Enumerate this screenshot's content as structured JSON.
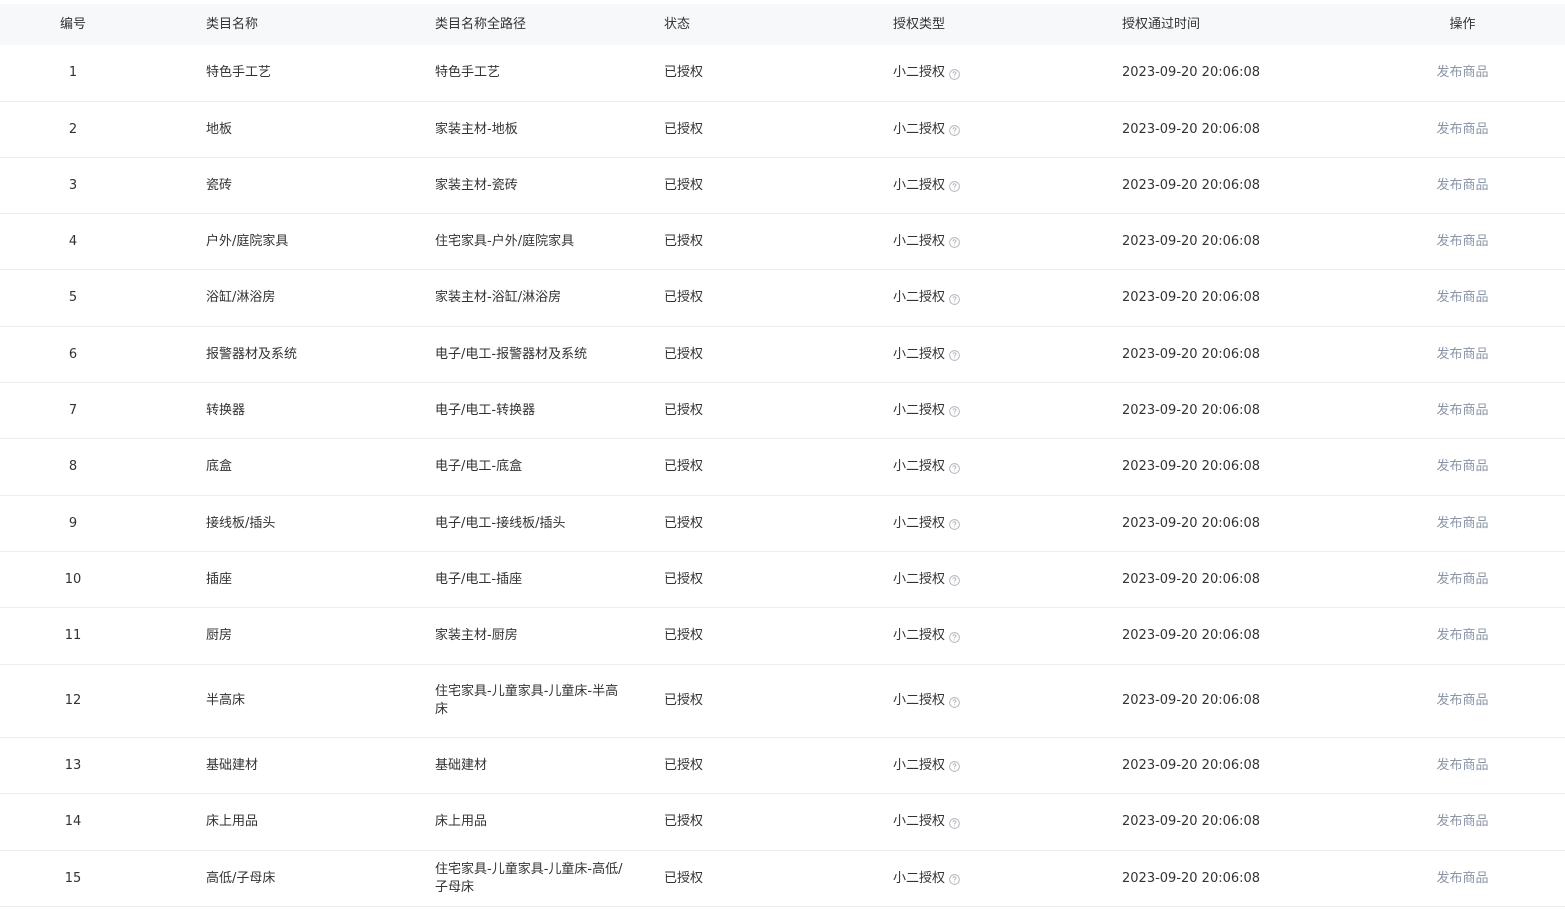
{
  "columns": {
    "no": "编号",
    "name": "类目名称",
    "path": "类目名称全路径",
    "status": "状态",
    "auth_type": "授权类型",
    "auth_time": "授权通过时间",
    "action": "操作"
  },
  "rows": [
    {
      "no": "1",
      "name": "特色手工艺",
      "path": "特色手工艺",
      "status": "已授权",
      "auth_type": "小二授权",
      "auth_time": "2023-09-20 20:06:08",
      "action": "发布商品"
    },
    {
      "no": "2",
      "name": "地板",
      "path": "家装主材-地板",
      "status": "已授权",
      "auth_type": "小二授权",
      "auth_time": "2023-09-20 20:06:08",
      "action": "发布商品"
    },
    {
      "no": "3",
      "name": "瓷砖",
      "path": "家装主材-瓷砖",
      "status": "已授权",
      "auth_type": "小二授权",
      "auth_time": "2023-09-20 20:06:08",
      "action": "发布商品"
    },
    {
      "no": "4",
      "name": "户外/庭院家具",
      "path": "住宅家具-户外/庭院家具",
      "status": "已授权",
      "auth_type": "小二授权",
      "auth_time": "2023-09-20 20:06:08",
      "action": "发布商品"
    },
    {
      "no": "5",
      "name": "浴缸/淋浴房",
      "path": "家装主材-浴缸/淋浴房",
      "status": "已授权",
      "auth_type": "小二授权",
      "auth_time": "2023-09-20 20:06:08",
      "action": "发布商品"
    },
    {
      "no": "6",
      "name": "报警器材及系统",
      "path": "电子/电工-报警器材及系统",
      "status": "已授权",
      "auth_type": "小二授权",
      "auth_time": "2023-09-20 20:06:08",
      "action": "发布商品"
    },
    {
      "no": "7",
      "name": "转换器",
      "path": "电子/电工-转换器",
      "status": "已授权",
      "auth_type": "小二授权",
      "auth_time": "2023-09-20 20:06:08",
      "action": "发布商品"
    },
    {
      "no": "8",
      "name": "底盒",
      "path": "电子/电工-底盒",
      "status": "已授权",
      "auth_type": "小二授权",
      "auth_time": "2023-09-20 20:06:08",
      "action": "发布商品"
    },
    {
      "no": "9",
      "name": "接线板/插头",
      "path": "电子/电工-接线板/插头",
      "status": "已授权",
      "auth_type": "小二授权",
      "auth_time": "2023-09-20 20:06:08",
      "action": "发布商品"
    },
    {
      "no": "10",
      "name": "插座",
      "path": "电子/电工-插座",
      "status": "已授权",
      "auth_type": "小二授权",
      "auth_time": "2023-09-20 20:06:08",
      "action": "发布商品"
    },
    {
      "no": "11",
      "name": "厨房",
      "path": "家装主材-厨房",
      "status": "已授权",
      "auth_type": "小二授权",
      "auth_time": "2023-09-20 20:06:08",
      "action": "发布商品"
    },
    {
      "no": "12",
      "name": "半高床",
      "path": "住宅家具-儿童家具-儿童床-半高床",
      "status": "已授权",
      "auth_type": "小二授权",
      "auth_time": "2023-09-20 20:06:08",
      "action": "发布商品"
    },
    {
      "no": "13",
      "name": "基础建材",
      "path": "基础建材",
      "status": "已授权",
      "auth_type": "小二授权",
      "auth_time": "2023-09-20 20:06:08",
      "action": "发布商品"
    },
    {
      "no": "14",
      "name": "床上用品",
      "path": "床上用品",
      "status": "已授权",
      "auth_type": "小二授权",
      "auth_time": "2023-09-20 20:06:08",
      "action": "发布商品"
    },
    {
      "no": "15",
      "name": "高低/子母床",
      "path": "住宅家具-儿童家具-儿童床-高低/子母床",
      "status": "已授权",
      "auth_type": "小二授权",
      "auth_time": "2023-09-20 20:06:08",
      "action": "发布商品"
    }
  ],
  "colors": {
    "header_bg": "#f7f8fa",
    "row_border": "#ebedf0",
    "link": "#8a94a6",
    "text": "#333333"
  },
  "icons": {
    "help": "question-circle-icon"
  }
}
